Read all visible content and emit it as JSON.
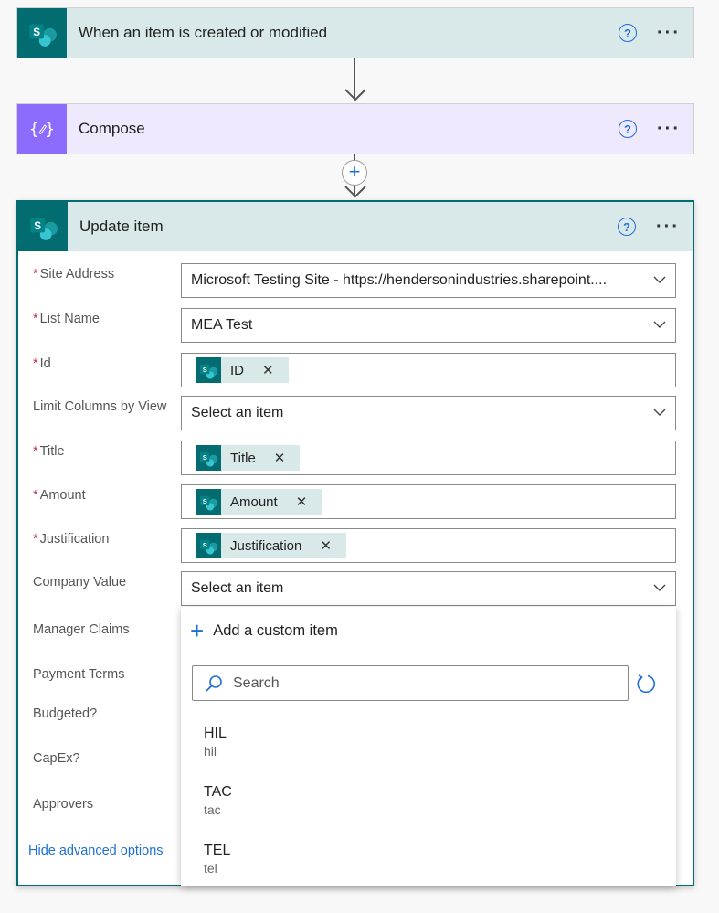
{
  "trigger": {
    "title": "When an item is created or modified",
    "icon": "sharepoint-icon"
  },
  "compose": {
    "title": "Compose",
    "icon": "braces-pencil-icon"
  },
  "update": {
    "title": "Update item",
    "fields": [
      {
        "label": "Site Address",
        "required": true,
        "value": "Microsoft Testing Site - https://hendersonindustries.sharepoint....",
        "type": "dropdown"
      },
      {
        "label": "List Name",
        "required": true,
        "value": "MEA Test",
        "type": "dropdown"
      },
      {
        "label": "Id",
        "required": true,
        "token": "ID",
        "type": "token"
      },
      {
        "label": "Limit Columns by View",
        "required": false,
        "value": "Select an item",
        "type": "dropdown"
      },
      {
        "label": "Title",
        "required": true,
        "token": "Title",
        "type": "token"
      },
      {
        "label": "Amount",
        "required": true,
        "token": "Amount",
        "type": "token"
      },
      {
        "label": "Justification",
        "required": true,
        "token": "Justification",
        "type": "token"
      },
      {
        "label": "Company Value",
        "required": false,
        "value": "Select an item",
        "type": "dropdown"
      }
    ],
    "more_fields": [
      "Manager Claims",
      "Payment Terms",
      "Budgeted?",
      "CapEx?",
      "Approvers"
    ],
    "hide_advanced": "Hide advanced options"
  },
  "dropdown": {
    "add_custom": "Add a custom item",
    "search_placeholder": "Search",
    "options": [
      {
        "label": "HIL",
        "value": "hil"
      },
      {
        "label": "TAC",
        "value": "tac"
      },
      {
        "label": "TEL",
        "value": "tel"
      }
    ]
  },
  "colors": {
    "sharepoint": "#036c70",
    "compose": "#8c6cff",
    "header": "#d9e9e9",
    "compose_header": "#eee9fd",
    "link": "#1f6fd6"
  }
}
